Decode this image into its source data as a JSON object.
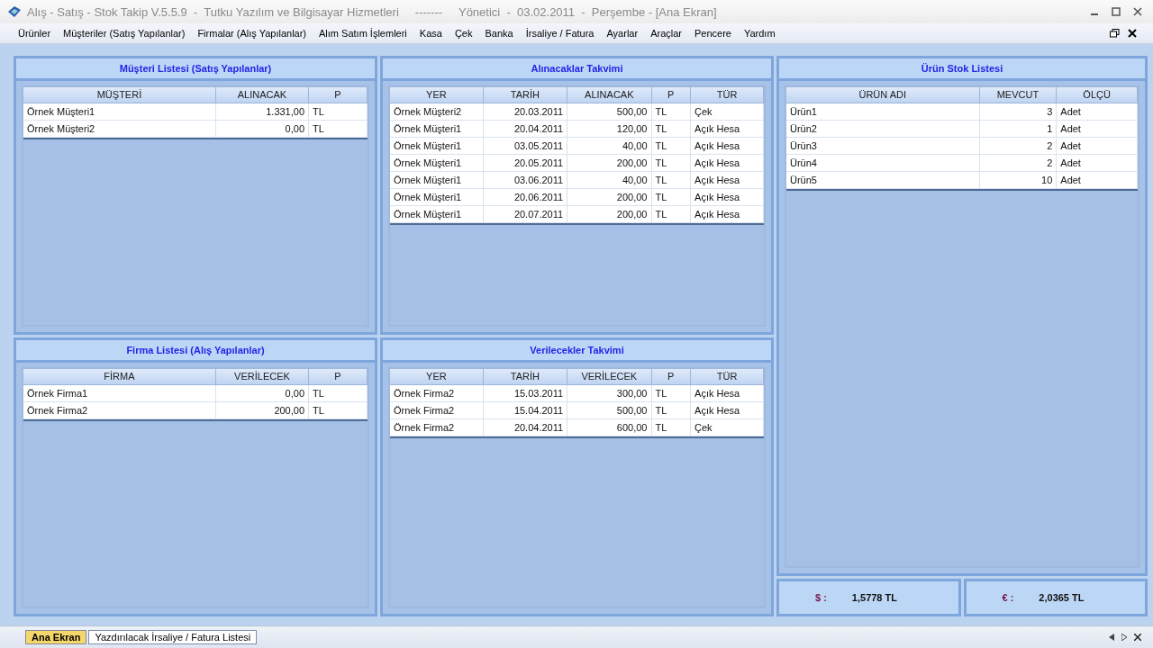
{
  "window": {
    "title": "Alış - Satış - Stok Takip V.5.5.9  -  Tutku Yazılım ve Bilgisayar Hizmetleri     -------     Yönetici  -  03.02.2011  -  Perşembe - [Ana Ekran]"
  },
  "menu": [
    "Ürünler",
    "Müşteriler (Satış Yapılanlar)",
    "Firmalar (Alış Yapılanlar)",
    "Alım Satım İşlemleri",
    "Kasa",
    "Çek",
    "Banka",
    "İrsaliye / Fatura",
    "Ayarlar",
    "Araçlar",
    "Pencere",
    "Yardım"
  ],
  "panels": [
    {
      "title": "Müşteri Listesi (Satış Yapılanlar)",
      "columns": [
        {
          "label": "MÜŞTERİ",
          "kind": "text"
        },
        {
          "label": "ALINACAK",
          "kind": "number"
        },
        {
          "label": "P",
          "kind": "text"
        }
      ],
      "rows": [
        [
          "Örnek Müşteri1",
          "1.331,00",
          "TL"
        ],
        [
          "Örnek Müşteri2",
          "0,00",
          "TL"
        ]
      ]
    },
    {
      "title": "Alınacaklar Takvimi",
      "columns": [
        {
          "label": "YER",
          "kind": "text"
        },
        {
          "label": "TARİH",
          "kind": "number"
        },
        {
          "label": "ALINACAK",
          "kind": "number"
        },
        {
          "label": "P",
          "kind": "text"
        },
        {
          "label": "TÜR",
          "kind": "text"
        }
      ],
      "rows": [
        [
          "Örnek Müşteri2",
          "20.03.2011",
          "500,00",
          "TL",
          "Çek"
        ],
        [
          "Örnek Müşteri1",
          "20.04.2011",
          "120,00",
          "TL",
          "Açık Hesa"
        ],
        [
          "Örnek Müşteri1",
          "03.05.2011",
          "40,00",
          "TL",
          "Açık Hesa"
        ],
        [
          "Örnek Müşteri1",
          "20.05.2011",
          "200,00",
          "TL",
          "Açık Hesa"
        ],
        [
          "Örnek Müşteri1",
          "03.06.2011",
          "40,00",
          "TL",
          "Açık Hesa"
        ],
        [
          "Örnek Müşteri1",
          "20.06.2011",
          "200,00",
          "TL",
          "Açık Hesa"
        ],
        [
          "Örnek Müşteri1",
          "20.07.2011",
          "200,00",
          "TL",
          "Açık Hesa"
        ]
      ]
    },
    {
      "title": "Ürün Stok Listesi",
      "columns": [
        {
          "label": "ÜRÜN ADI",
          "kind": "text"
        },
        {
          "label": "MEVCUT",
          "kind": "number"
        },
        {
          "label": "ÖLÇÜ",
          "kind": "text"
        }
      ],
      "rows": [
        [
          "Ürün1",
          "3",
          "Adet"
        ],
        [
          "Ürün2",
          "1",
          "Adet"
        ],
        [
          "Ürün3",
          "2",
          "Adet"
        ],
        [
          "Ürün4",
          "2",
          "Adet"
        ],
        [
          "Ürün5",
          "10",
          "Adet"
        ]
      ]
    },
    {
      "title": "Firma Listesi (Alış Yapılanlar)",
      "columns": [
        {
          "label": "FİRMA",
          "kind": "text"
        },
        {
          "label": "VERİLECEK",
          "kind": "number"
        },
        {
          "label": "P",
          "kind": "text"
        }
      ],
      "rows": [
        [
          "Örnek Firma1",
          "0,00",
          "TL"
        ],
        [
          "Örnek Firma2",
          "200,00",
          "TL"
        ]
      ]
    },
    {
      "title": "Verilecekler Takvimi",
      "columns": [
        {
          "label": "YER",
          "kind": "text"
        },
        {
          "label": "TARİH",
          "kind": "number"
        },
        {
          "label": "VERİLECEK",
          "kind": "number"
        },
        {
          "label": "P",
          "kind": "text"
        },
        {
          "label": "TÜR",
          "kind": "text"
        }
      ],
      "rows": [
        [
          "Örnek Firma2",
          "15.03.2011",
          "300,00",
          "TL",
          "Açık Hesa"
        ],
        [
          "Örnek Firma2",
          "15.04.2011",
          "500,00",
          "TL",
          "Açık Hesa"
        ],
        [
          "Örnek Firma2",
          "20.04.2011",
          "600,00",
          "TL",
          "Çek"
        ]
      ]
    }
  ],
  "currency": [
    {
      "symbol": "$ :",
      "value": "1,5778 TL"
    },
    {
      "symbol": "€ :",
      "value": "2,0365 TL"
    }
  ],
  "tabs": [
    {
      "label": "Ana Ekran",
      "selected": true
    },
    {
      "label": "Yazdırılacak İrsaliye / Fatura Listesi",
      "selected": false
    }
  ]
}
